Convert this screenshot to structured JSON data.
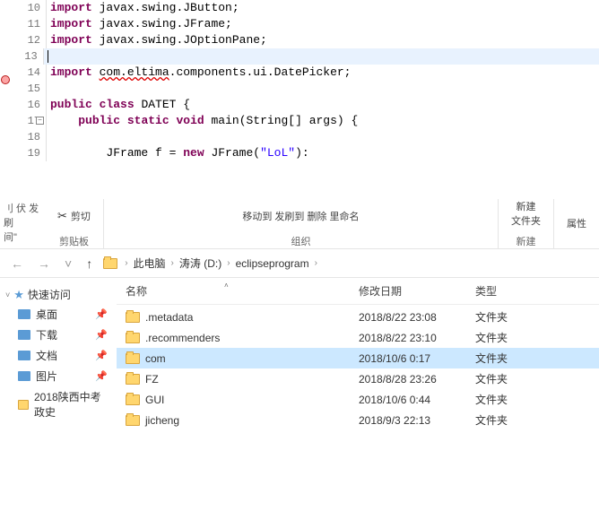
{
  "code": {
    "lines": [
      {
        "num": "10",
        "marker": "",
        "segments": [
          {
            "cls": "kw-import",
            "t": "import"
          },
          {
            "cls": "",
            "t": " "
          },
          {
            "cls": "pkg",
            "t": "javax.swing.JButton;"
          }
        ]
      },
      {
        "num": "11",
        "marker": "",
        "segments": [
          {
            "cls": "kw-import",
            "t": "import"
          },
          {
            "cls": "",
            "t": " "
          },
          {
            "cls": "pkg",
            "t": "javax.swing.JFrame;"
          }
        ]
      },
      {
        "num": "12",
        "marker": "",
        "segments": [
          {
            "cls": "kw-import",
            "t": "import"
          },
          {
            "cls": "",
            "t": " "
          },
          {
            "cls": "pkg",
            "t": "javax.swing.JOptionPane;"
          }
        ]
      },
      {
        "num": "13",
        "marker": "",
        "highlighted": true,
        "segments": [
          {
            "cls": "",
            "t": ""
          }
        ]
      },
      {
        "num": "14",
        "marker": "err",
        "segments": [
          {
            "cls": "kw-import",
            "t": "import"
          },
          {
            "cls": "",
            "t": " "
          },
          {
            "cls": "pkg-underline",
            "t": "com.eltima"
          },
          {
            "cls": "pkg",
            "t": ".components.ui.DatePicker;"
          }
        ]
      },
      {
        "num": "15",
        "marker": "",
        "segments": []
      },
      {
        "num": "16",
        "marker": "",
        "segments": [
          {
            "cls": "kw-public",
            "t": "public"
          },
          {
            "cls": "",
            "t": " "
          },
          {
            "cls": "kw-class",
            "t": "class"
          },
          {
            "cls": "",
            "t": " DATET {"
          }
        ]
      },
      {
        "num": "17",
        "marker": "fold",
        "segments": [
          {
            "cls": "",
            "t": "    "
          },
          {
            "cls": "kw-public",
            "t": "public"
          },
          {
            "cls": "",
            "t": " "
          },
          {
            "cls": "kw-static",
            "t": "static"
          },
          {
            "cls": "",
            "t": " "
          },
          {
            "cls": "kw-void",
            "t": "void"
          },
          {
            "cls": "",
            "t": " main(String[] args) {"
          }
        ]
      },
      {
        "num": "18",
        "marker": "",
        "segments": []
      },
      {
        "num": "19",
        "marker": "",
        "segments": [
          {
            "cls": "",
            "t": "        JFrame f = "
          },
          {
            "cls": "kw-new",
            "t": "new"
          },
          {
            "cls": "",
            "t": " JFrame("
          },
          {
            "cls": "str",
            "t": "\"LoL\""
          },
          {
            "cls": "",
            "t": "):"
          }
        ]
      }
    ]
  },
  "ribbon": {
    "left1": "刂 伏 发刷",
    "left2": "间\"",
    "cut_label": "剪切",
    "group1_label": "剪贴板",
    "mid_text": "移动到 发刷到   删除  里命名",
    "group2_label": "组织",
    "new_folder": "新建",
    "folder_text": "文件夹",
    "group3_label": "新建",
    "props": "属性"
  },
  "breadcrumb": {
    "items": [
      "此电脑",
      "涛涛 (D:)",
      "eclipseprogram"
    ]
  },
  "sidebar": {
    "quick_access": "快速访问",
    "items": [
      {
        "icon": "desktop",
        "label": "桌面",
        "pinned": true
      },
      {
        "icon": "download",
        "label": "下载",
        "pinned": true
      },
      {
        "icon": "doc",
        "label": "文档",
        "pinned": true
      },
      {
        "icon": "pic",
        "label": "图片",
        "pinned": true
      },
      {
        "icon": "folder",
        "label": "2018陕西中考政史",
        "pinned": false
      }
    ]
  },
  "filelist": {
    "headers": {
      "name": "名称",
      "date": "修改日期",
      "type": "类型"
    },
    "rows": [
      {
        "name": ".metadata",
        "date": "2018/8/22 23:08",
        "type": "文件夹",
        "selected": false
      },
      {
        "name": ".recommenders",
        "date": "2018/8/22 23:10",
        "type": "文件夹",
        "selected": false
      },
      {
        "name": "com",
        "date": "2018/10/6 0:17",
        "type": "文件夹",
        "selected": true
      },
      {
        "name": "FZ",
        "date": "2018/8/28 23:26",
        "type": "文件夹",
        "selected": false
      },
      {
        "name": "GUI",
        "date": "2018/10/6 0:44",
        "type": "文件夹",
        "selected": false
      },
      {
        "name": "jicheng",
        "date": "2018/9/3 22:13",
        "type": "文件夹",
        "selected": false
      }
    ]
  }
}
